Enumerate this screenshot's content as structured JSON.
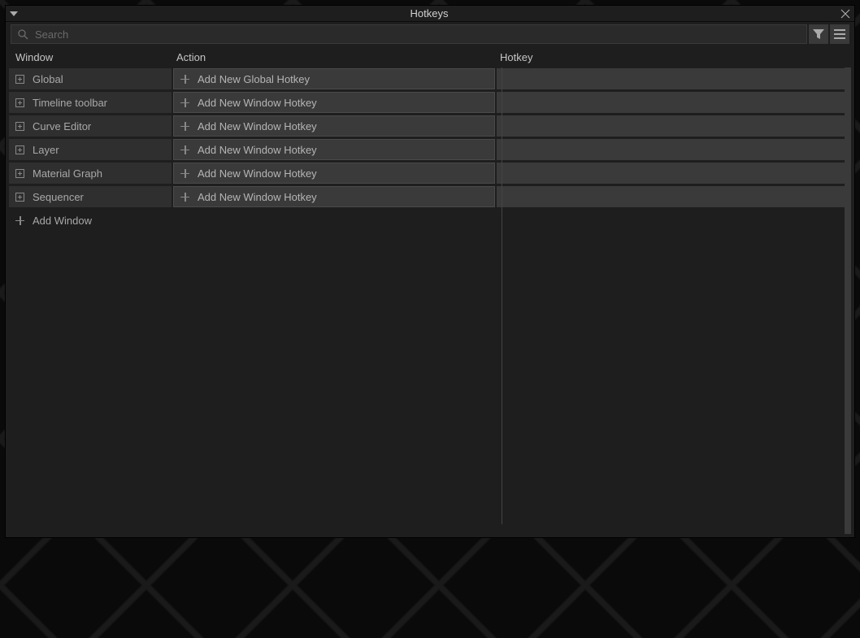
{
  "dialog": {
    "title": "Hotkeys"
  },
  "search": {
    "placeholder": "Search"
  },
  "columns": {
    "window": "Window",
    "action": "Action",
    "hotkey": "Hotkey"
  },
  "rows": [
    {
      "window": "Global",
      "action": "Add New Global Hotkey"
    },
    {
      "window": "Timeline toolbar",
      "action": "Add New Window Hotkey"
    },
    {
      "window": "Curve Editor",
      "action": "Add New Window Hotkey"
    },
    {
      "window": "Layer",
      "action": "Add New Window Hotkey"
    },
    {
      "window": "Material Graph",
      "action": "Add New Window Hotkey"
    },
    {
      "window": "Sequencer",
      "action": "Add New Window Hotkey"
    }
  ],
  "addWindow": "Add Window"
}
